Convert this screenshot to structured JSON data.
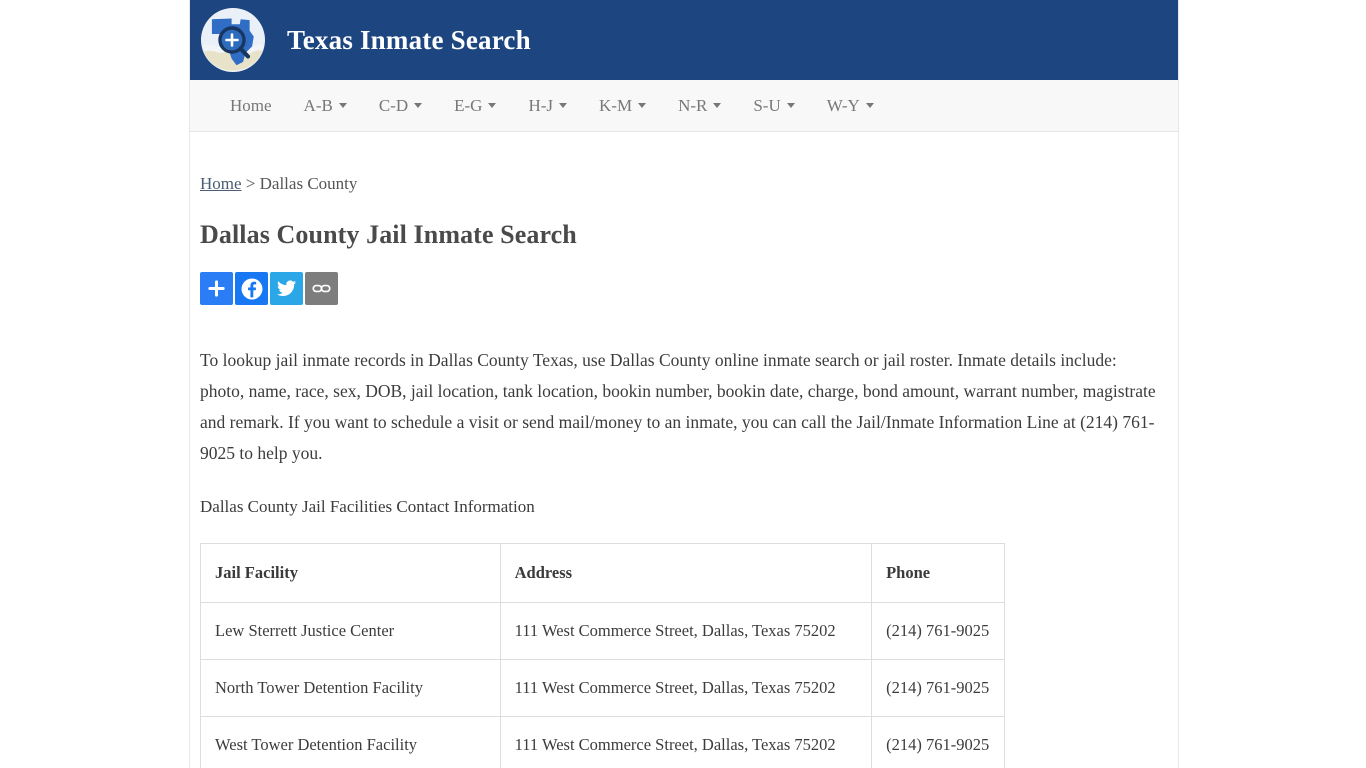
{
  "site": {
    "title": "Texas Inmate Search",
    "logo_icon": "texas-map-magnifier-icon",
    "header_bg": "#1d4580"
  },
  "nav": {
    "items": [
      {
        "label": "Home",
        "has_caret": false
      },
      {
        "label": "A-B",
        "has_caret": true
      },
      {
        "label": "C-D",
        "has_caret": true
      },
      {
        "label": "E-G",
        "has_caret": true
      },
      {
        "label": "H-J",
        "has_caret": true
      },
      {
        "label": "K-M",
        "has_caret": true
      },
      {
        "label": "N-R",
        "has_caret": true
      },
      {
        "label": "S-U",
        "has_caret": true
      },
      {
        "label": "W-Y",
        "has_caret": true
      }
    ]
  },
  "breadcrumb": {
    "home_label": "Home",
    "separator": ">",
    "current": "Dallas County"
  },
  "page": {
    "title": "Dallas County Jail Inmate Search",
    "paragraph": "To lookup jail inmate records in Dallas County Texas, use Dallas County online inmate search or jail roster. Inmate details include: photo, name, race, sex, DOB, jail location, tank location, bookin number, bookin date, charge, bond amount, warrant number, magistrate and remark. If you want to schedule a visit or send mail/money to an inmate, you can call the Jail/Inmate Information Line at (214) 761-9025 to help you.",
    "table_caption": "Dallas County Jail Facilities Contact Information"
  },
  "share": {
    "buttons": [
      {
        "name": "addthis",
        "icon": "plus-icon",
        "color": "#2a7df4"
      },
      {
        "name": "facebook",
        "icon": "facebook-icon",
        "color": "#1877f2"
      },
      {
        "name": "twitter",
        "icon": "twitter-bird-icon",
        "color": "#2ba7e8"
      },
      {
        "name": "copy-link",
        "icon": "chain-link-icon",
        "color": "#7d7d7d"
      }
    ]
  },
  "table": {
    "headers": [
      "Jail Facility",
      "Address",
      "Phone"
    ],
    "rows": [
      {
        "facility": "Lew Sterrett Justice Center",
        "address": "111 West Commerce Street, Dallas, Texas 75202",
        "phone": "(214) 761-9025"
      },
      {
        "facility": "North Tower Detention Facility",
        "address": "111 West Commerce Street, Dallas, Texas 75202",
        "phone": "(214) 761-9025"
      },
      {
        "facility": "West Tower Detention Facility",
        "address": "111 West Commerce Street, Dallas, Texas 75202",
        "phone": "(214) 761-9025"
      }
    ]
  }
}
